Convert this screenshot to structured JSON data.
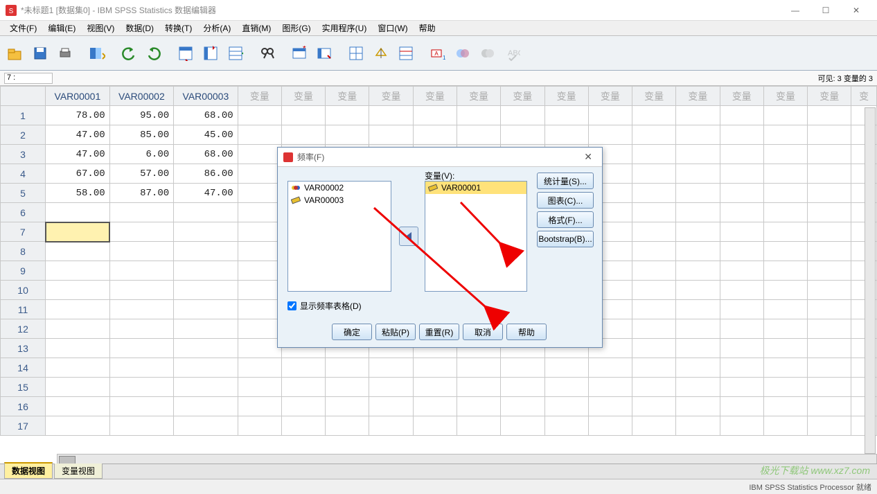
{
  "window": {
    "title": "*未标题1 [数据集0] - IBM SPSS Statistics 数据编辑器",
    "min": "—",
    "max": "☐",
    "close": "✕"
  },
  "menu": [
    "文件(F)",
    "编辑(E)",
    "视图(V)",
    "数据(D)",
    "转换(T)",
    "分析(A)",
    "直销(M)",
    "图形(G)",
    "实用程序(U)",
    "窗口(W)",
    "帮助"
  ],
  "infobar": {
    "cell": "7 :",
    "visible": "可见: 3 变量的 3"
  },
  "columns": [
    "VAR00001",
    "VAR00002",
    "VAR00003"
  ],
  "placeholder_col": "变量",
  "placeholder_trunc": "变",
  "data_rows": [
    [
      "78.00",
      "95.00",
      "68.00"
    ],
    [
      "47.00",
      "85.00",
      "45.00"
    ],
    [
      "47.00",
      "6.00",
      "68.00"
    ],
    [
      "67.00",
      "57.00",
      "86.00"
    ],
    [
      "58.00",
      "87.00",
      "47.00"
    ]
  ],
  "blank_row_count": 12,
  "tabs": {
    "data": "数据视图",
    "var": "变量视图"
  },
  "status": {
    "processor": "IBM SPSS Statistics Processor 就绪"
  },
  "watermark": "极光下载站  www.xz7.com",
  "dialog": {
    "title": "频率(F)",
    "var_label": "变量(V):",
    "left_items": [
      "VAR00002",
      "VAR00003"
    ],
    "right_items": [
      "VAR00001"
    ],
    "side_buttons": [
      "统计量(S)...",
      "图表(C)...",
      "格式(F)...",
      "Bootstrap(B)..."
    ],
    "checkbox": "显示频率表格(D)",
    "bottom": {
      "ok": "确定",
      "paste": "粘贴(P)",
      "reset": "重置(R)",
      "cancel": "取消",
      "help": "帮助"
    }
  }
}
